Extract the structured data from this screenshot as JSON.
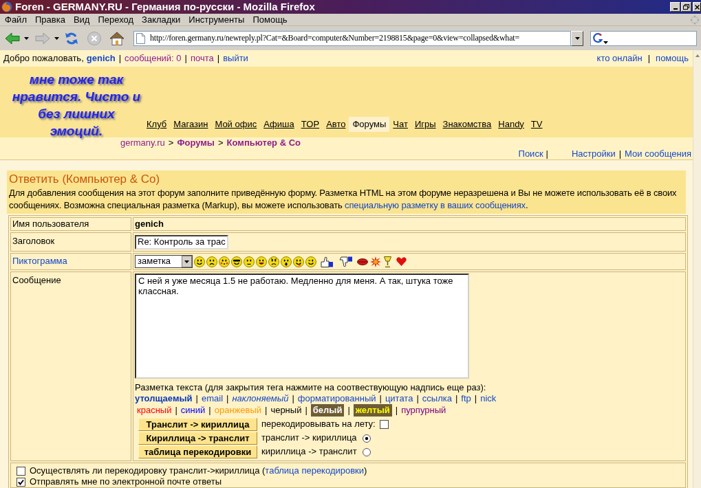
{
  "window": {
    "title": "Foren - GERMANY.RU - Германия по-русски - Mozilla Firefox"
  },
  "menu": [
    "Файл",
    "Правка",
    "Вид",
    "Переход",
    "Закладки",
    "Инструменты",
    "Помощь"
  ],
  "toolbar": {
    "url": "http://foren.germany.ru/newreply.pl?Cat=&Board=computer&Number=2198815&page=0&view=collapsed&what="
  },
  "user_bar": {
    "greeting": "Добро пожаловать,",
    "separator": "|",
    "links": [
      {
        "label": "genich",
        "visited": false,
        "bold": true
      },
      {
        "label": "сообщений: 0",
        "visited": true,
        "bold": false
      },
      {
        "label": "почта",
        "visited": true,
        "bold": false
      },
      {
        "label": "выйти",
        "visited": false,
        "bold": false
      }
    ],
    "right_links": [
      {
        "label": "кто онлайн",
        "visited": false
      },
      {
        "label": "помощь",
        "visited": false
      }
    ]
  },
  "note": "мне тоже так нравится. Чисто и без лишних эмоций.",
  "nav_tabs": [
    {
      "label": "Клуб",
      "selected": false
    },
    {
      "label": "Магазин",
      "selected": false
    },
    {
      "label": "Мой офис",
      "selected": false
    },
    {
      "label": "Афиша",
      "selected": false
    },
    {
      "label": "TOP",
      "selected": false
    },
    {
      "label": "Авто",
      "selected": false
    },
    {
      "label": "Форумы",
      "selected": true
    },
    {
      "label": "Чат",
      "selected": false
    },
    {
      "label": "Игры",
      "selected": false
    },
    {
      "label": "Знакомства",
      "selected": false
    },
    {
      "label": "Handy",
      "selected": false
    },
    {
      "label": "TV",
      "selected": false
    }
  ],
  "breadcrumb": {
    "separator": ">",
    "items": [
      {
        "label": "germany.ru",
        "bold": false
      },
      {
        "label": "Форумы",
        "bold": true
      },
      {
        "label": "Компьютер & Co",
        "bold": true
      }
    ]
  },
  "tools": {
    "separator": "|",
    "links": [
      "Поиск",
      "Настройки",
      "Мои сообщения"
    ]
  },
  "form": {
    "title": "Ответить (Компьютер & Co)",
    "intro": "Для добавления сообщения на этот форум заполните приведённую форму. Разметка HTML на этом форуме неразрешена и Вы не можете использовать её в своих сообщениях. Возможна специальная разметка (Markup), вы можете использовать",
    "intro_link": "специальную разметку в ваших сообщениях",
    "intro_end": ".",
    "username": {
      "label": "Имя пользователя",
      "value": "genich"
    },
    "subject": {
      "label": "Заголовок",
      "value": "Re: Контроль за трас"
    },
    "icon": {
      "label": "Пиктограмма",
      "value": "заметка"
    },
    "message": {
      "label": "Сообщение",
      "value": "С ней я уже месяца 1.5 не работаю. Медленно для меня. А так, штука тоже классная."
    }
  },
  "markup": {
    "hint": "Разметка текста (для закрытия тега нажмите на соотвествующую надпись еще раз):",
    "separator": "|",
    "tags": [
      {
        "label": "утолщаемый",
        "kind": "bold"
      },
      {
        "label": "email",
        "kind": "plain"
      },
      {
        "label": "наклоняемый",
        "kind": "italic"
      },
      {
        "label": "форматированный",
        "kind": "plain"
      },
      {
        "label": "цитата",
        "kind": "plain"
      },
      {
        "label": "ссылка",
        "kind": "plain"
      },
      {
        "label": "ftp",
        "kind": "plain"
      },
      {
        "label": "nick",
        "kind": "plain"
      }
    ],
    "colors": [
      {
        "label": "красный",
        "color": "#ff0000"
      },
      {
        "label": "синий",
        "color": "#0000ff"
      },
      {
        "label": "оранжевый",
        "color": "#ff9900"
      },
      {
        "label": "черный",
        "color": "#000000"
      },
      {
        "label": "белый",
        "color": "#ffffff"
      },
      {
        "label": "желтый",
        "color": "#ffff00"
      },
      {
        "label": "пурпурный",
        "color": "#800080"
      }
    ]
  },
  "translit": {
    "buttons": [
      "Транслит -> кириллица",
      "Кириллица -> транслит",
      "таблица перекодировки"
    ],
    "on_the_fly": {
      "label": "перекодировывать на лету:",
      "checked": false
    },
    "modes": [
      {
        "label": "транслит -> кириллица",
        "selected": true
      },
      {
        "label": "кириллица -> транслит",
        "selected": false
      }
    ]
  },
  "options": [
    {
      "label": "Осуществлять ли перекодировку транслит->кириллица (",
      "link": "таблица перекодировки",
      "end": ")",
      "checked": false
    },
    {
      "label": "Отправлять мне по электронной почте ответы",
      "checked": true
    }
  ]
}
